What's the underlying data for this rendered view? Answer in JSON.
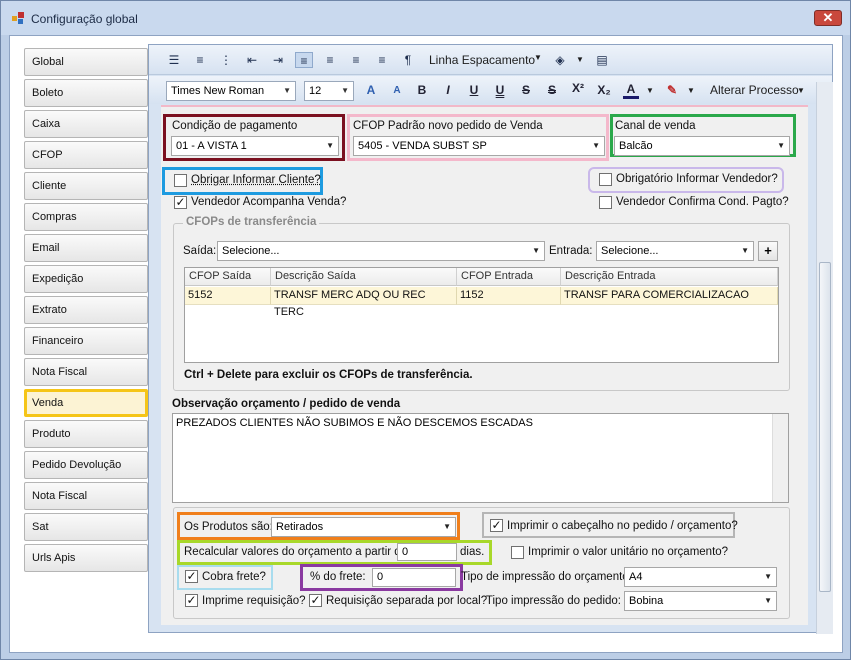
{
  "window": {
    "title": "Configuração global"
  },
  "nav": {
    "items": [
      "Global",
      "Boleto",
      "Caixa",
      "CFOP",
      "Cliente",
      "Compras",
      "Email",
      "Expedição",
      "Extrato",
      "Financeiro",
      "Nota Fiscal",
      "Venda",
      "Produto",
      "Pedido Devolução",
      "Nota Fiscal Consumidor",
      "Sat",
      "Urls Apis"
    ],
    "selected": "Venda"
  },
  "toolbar": {
    "line_spacing": "Linha Espacamento",
    "font_name": "Times New Roman",
    "font_size": "12",
    "alter_process": "Alterar Processo"
  },
  "form": {
    "payment_label": "Condição de pagamento",
    "payment_value": "01 - A VISTA 1",
    "cfop_label": "CFOP Padrão novo pedido de Venda",
    "cfop_value": "5405 - VENDA SUBST SP",
    "channel_label": "Canal de venda",
    "channel_value": "Balcão",
    "require_client": "Obrigar Informar Cliente?",
    "require_client_checked": false,
    "require_seller": "Obrigatório Informar Vendedor?",
    "require_seller_checked": false,
    "seller_follows": "Vendedor Acompanha Venda?",
    "seller_follows_checked": true,
    "seller_confirms": "Vendedor Confirma Cond. Pagto?",
    "seller_confirms_checked": false,
    "transfer_group": "CFOPs de transferência",
    "exit_label": "Saída:",
    "exit_value": "Selecione...",
    "entry_label": "Entrada:",
    "entry_value": "Selecione...",
    "add_button": "+",
    "grid_headers": [
      "CFOP Saída",
      "Descrição Saída",
      "CFOP Entrada",
      "Descrição Entrada"
    ],
    "grid_rows": [
      [
        "5152",
        "TRANSF MERC ADQ OU REC TERC",
        "1152",
        "TRANSF PARA COMERCIALIZACAO"
      ]
    ],
    "grid_hint": "Ctrl + Delete para excluir os CFOPs de transferência.",
    "obs_label": "Observação orçamento / pedido de venda",
    "obs_value": "PREZADOS CLIENTES NÃO SUBIMOS E NÃO DESCEMOS ESCADAS",
    "products_label": "Os Produtos são:",
    "products_value": "Retirados",
    "print_header": "Imprimir o cabeçalho no pedido / orçamento?",
    "print_header_checked": true,
    "recalc_label": "Recalcular valores do orçamento a partir de",
    "recalc_value": "0",
    "recalc_unit": "dias.",
    "print_unit_value": "Imprimir o valor unitário no orçamento?",
    "print_unit_value_checked": false,
    "charge_freight": "Cobra frete?",
    "charge_freight_checked": true,
    "freight_pct_label": "% do frete:",
    "freight_pct_value": "0",
    "quote_print_type_label": "Tipo de impressão do orçamento:",
    "quote_print_type_value": "A4",
    "print_request": "Imprime requisição?",
    "print_request_checked": true,
    "request_by_location": "Requisição separada por local?",
    "request_by_location_checked": true,
    "order_print_type_label": "Tipo impressão do pedido:",
    "order_print_type_value": "Bobina"
  },
  "highlight_colors": {
    "payment": "#7b1020",
    "cfop": "#f4b8cb",
    "channel": "#2aa84a",
    "require_client": "#1e9be0",
    "seller": "#c9b8ea",
    "venda_nav": "#f5c518",
    "products": "#f07f1b",
    "print_header": "#b5b5b5",
    "recalc": "#a8d82a",
    "freight": "#a8dcee",
    "freight_pct": "#8a3aa0"
  }
}
